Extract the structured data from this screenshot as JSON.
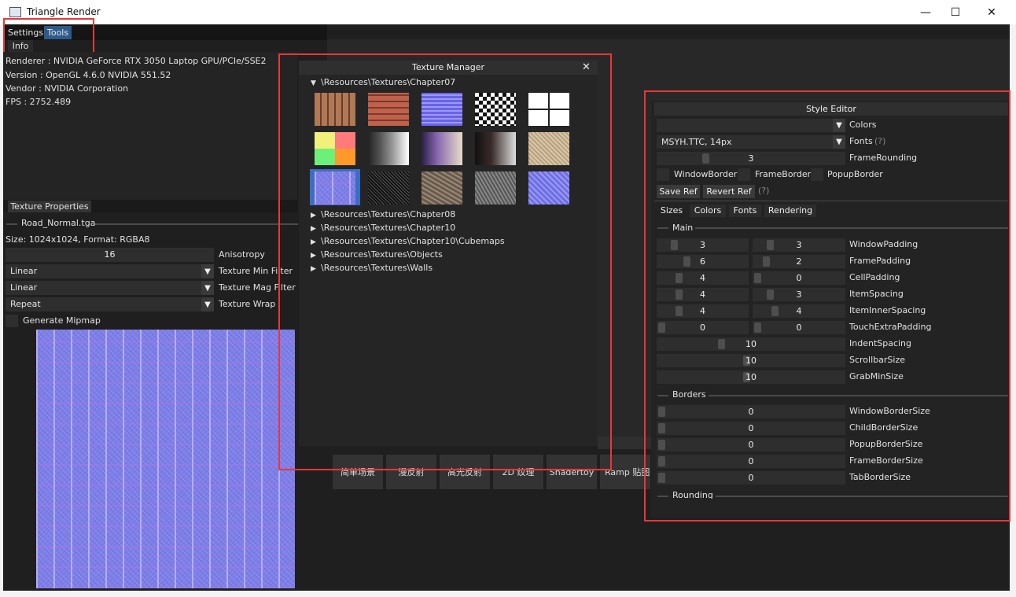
{
  "window": {
    "title": "Triangle Render"
  },
  "menu": {
    "settings": "Settings",
    "tools": "Tools"
  },
  "info": {
    "tab": "Info",
    "renderer": "Renderer : NVIDIA GeForce RTX 3050 Laptop GPU/PCIe/SSE2",
    "version": "Version : OpenGL 4.6.0 NVIDIA 551.52",
    "vendor": "Vendor : NVIDIA Corporation",
    "fps": "FPS : 2752.489"
  },
  "texture_properties": {
    "tab": "Texture Properties",
    "file": "Road_Normal.tga",
    "size": "Size: 1024x1024, Format: RGBA8",
    "anisotropy_value": "16",
    "anisotropy_label": "Anisotropy",
    "min_filter_value": "Linear",
    "min_filter_label": "Texture Min Filter",
    "mag_filter_value": "Linear",
    "mag_filter_label": "Texture Mag Filter",
    "wrap_value": "Repeat",
    "wrap_label": "Texture Wrap",
    "mipmap_label": "Generate Mipmap"
  },
  "texture_manager": {
    "title": "Texture Manager",
    "folders": [
      "\\Resources\\Textures\\Chapter07",
      "\\Resources\\Textures\\Chapter08",
      "\\Resources\\Textures\\Chapter10",
      "\\Resources\\Textures\\Chapter10\\Cubemaps",
      "\\Resources\\Textures\\Objects",
      "\\Resources\\Textures\\Walls"
    ]
  },
  "bottom_buttons": [
    "简单场景",
    "漫反射",
    "高光反射",
    "2D 纹理",
    "Shadertoy",
    "Ramp 贴图"
  ],
  "style_editor": {
    "title": "Style Editor",
    "colors_label": "Colors",
    "font_value": "MSYH.TTC, 14px",
    "fonts_label": "Fonts",
    "fonts_help": "(?)",
    "frame_rounding_value": "3",
    "frame_rounding_label": "FrameRounding",
    "window_border": "WindowBorder",
    "frame_border": "FrameBorder",
    "popup_border": "PopupBorder",
    "save_ref": "Save Ref",
    "revert_ref": "Revert Ref",
    "ref_help": "(?)",
    "tabs": [
      "Sizes",
      "Colors",
      "Fonts",
      "Rendering"
    ],
    "main_header": "Main",
    "main_rows": [
      {
        "a": "3",
        "b": "3",
        "label": "WindowPadding"
      },
      {
        "a": "6",
        "b": "2",
        "label": "FramePadding"
      },
      {
        "a": "4",
        "b": "0",
        "label": "CellPadding"
      },
      {
        "a": "4",
        "b": "3",
        "label": "ItemSpacing"
      },
      {
        "a": "4",
        "b": "4",
        "label": "ItemInnerSpacing"
      },
      {
        "a": "0",
        "b": "0",
        "label": "TouchExtraPadding"
      }
    ],
    "single_rows": [
      {
        "v": "10",
        "label": "IndentSpacing"
      },
      {
        "v": "10",
        "label": "ScrollbarSize"
      },
      {
        "v": "10",
        "label": "GrabMinSize"
      }
    ],
    "borders_header": "Borders",
    "border_rows": [
      {
        "v": "0",
        "label": "WindowBorderSize"
      },
      {
        "v": "0",
        "label": "ChildBorderSize"
      },
      {
        "v": "0",
        "label": "PopupBorderSize"
      },
      {
        "v": "0",
        "label": "FrameBorderSize"
      },
      {
        "v": "0",
        "label": "TabBorderSize"
      }
    ],
    "rounding_header": "Rounding"
  }
}
